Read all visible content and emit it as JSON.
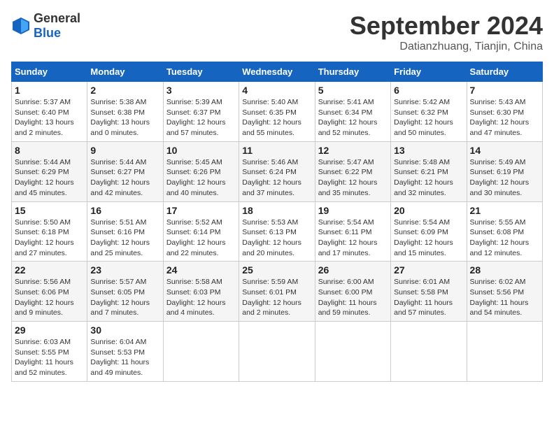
{
  "logo": {
    "general": "General",
    "blue": "Blue"
  },
  "header": {
    "month": "September 2024",
    "location": "Datianzhuang, Tianjin, China"
  },
  "weekdays": [
    "Sunday",
    "Monday",
    "Tuesday",
    "Wednesday",
    "Thursday",
    "Friday",
    "Saturday"
  ],
  "weeks": [
    [
      {
        "day": "1",
        "sunrise": "Sunrise: 5:37 AM",
        "sunset": "Sunset: 6:40 PM",
        "daylight": "Daylight: 13 hours and 2 minutes."
      },
      {
        "day": "2",
        "sunrise": "Sunrise: 5:38 AM",
        "sunset": "Sunset: 6:38 PM",
        "daylight": "Daylight: 13 hours and 0 minutes."
      },
      {
        "day": "3",
        "sunrise": "Sunrise: 5:39 AM",
        "sunset": "Sunset: 6:37 PM",
        "daylight": "Daylight: 12 hours and 57 minutes."
      },
      {
        "day": "4",
        "sunrise": "Sunrise: 5:40 AM",
        "sunset": "Sunset: 6:35 PM",
        "daylight": "Daylight: 12 hours and 55 minutes."
      },
      {
        "day": "5",
        "sunrise": "Sunrise: 5:41 AM",
        "sunset": "Sunset: 6:34 PM",
        "daylight": "Daylight: 12 hours and 52 minutes."
      },
      {
        "day": "6",
        "sunrise": "Sunrise: 5:42 AM",
        "sunset": "Sunset: 6:32 PM",
        "daylight": "Daylight: 12 hours and 50 minutes."
      },
      {
        "day": "7",
        "sunrise": "Sunrise: 5:43 AM",
        "sunset": "Sunset: 6:30 PM",
        "daylight": "Daylight: 12 hours and 47 minutes."
      }
    ],
    [
      {
        "day": "8",
        "sunrise": "Sunrise: 5:44 AM",
        "sunset": "Sunset: 6:29 PM",
        "daylight": "Daylight: 12 hours and 45 minutes."
      },
      {
        "day": "9",
        "sunrise": "Sunrise: 5:44 AM",
        "sunset": "Sunset: 6:27 PM",
        "daylight": "Daylight: 12 hours and 42 minutes."
      },
      {
        "day": "10",
        "sunrise": "Sunrise: 5:45 AM",
        "sunset": "Sunset: 6:26 PM",
        "daylight": "Daylight: 12 hours and 40 minutes."
      },
      {
        "day": "11",
        "sunrise": "Sunrise: 5:46 AM",
        "sunset": "Sunset: 6:24 PM",
        "daylight": "Daylight: 12 hours and 37 minutes."
      },
      {
        "day": "12",
        "sunrise": "Sunrise: 5:47 AM",
        "sunset": "Sunset: 6:22 PM",
        "daylight": "Daylight: 12 hours and 35 minutes."
      },
      {
        "day": "13",
        "sunrise": "Sunrise: 5:48 AM",
        "sunset": "Sunset: 6:21 PM",
        "daylight": "Daylight: 12 hours and 32 minutes."
      },
      {
        "day": "14",
        "sunrise": "Sunrise: 5:49 AM",
        "sunset": "Sunset: 6:19 PM",
        "daylight": "Daylight: 12 hours and 30 minutes."
      }
    ],
    [
      {
        "day": "15",
        "sunrise": "Sunrise: 5:50 AM",
        "sunset": "Sunset: 6:18 PM",
        "daylight": "Daylight: 12 hours and 27 minutes."
      },
      {
        "day": "16",
        "sunrise": "Sunrise: 5:51 AM",
        "sunset": "Sunset: 6:16 PM",
        "daylight": "Daylight: 12 hours and 25 minutes."
      },
      {
        "day": "17",
        "sunrise": "Sunrise: 5:52 AM",
        "sunset": "Sunset: 6:14 PM",
        "daylight": "Daylight: 12 hours and 22 minutes."
      },
      {
        "day": "18",
        "sunrise": "Sunrise: 5:53 AM",
        "sunset": "Sunset: 6:13 PM",
        "daylight": "Daylight: 12 hours and 20 minutes."
      },
      {
        "day": "19",
        "sunrise": "Sunrise: 5:54 AM",
        "sunset": "Sunset: 6:11 PM",
        "daylight": "Daylight: 12 hours and 17 minutes."
      },
      {
        "day": "20",
        "sunrise": "Sunrise: 5:54 AM",
        "sunset": "Sunset: 6:09 PM",
        "daylight": "Daylight: 12 hours and 15 minutes."
      },
      {
        "day": "21",
        "sunrise": "Sunrise: 5:55 AM",
        "sunset": "Sunset: 6:08 PM",
        "daylight": "Daylight: 12 hours and 12 minutes."
      }
    ],
    [
      {
        "day": "22",
        "sunrise": "Sunrise: 5:56 AM",
        "sunset": "Sunset: 6:06 PM",
        "daylight": "Daylight: 12 hours and 9 minutes."
      },
      {
        "day": "23",
        "sunrise": "Sunrise: 5:57 AM",
        "sunset": "Sunset: 6:05 PM",
        "daylight": "Daylight: 12 hours and 7 minutes."
      },
      {
        "day": "24",
        "sunrise": "Sunrise: 5:58 AM",
        "sunset": "Sunset: 6:03 PM",
        "daylight": "Daylight: 12 hours and 4 minutes."
      },
      {
        "day": "25",
        "sunrise": "Sunrise: 5:59 AM",
        "sunset": "Sunset: 6:01 PM",
        "daylight": "Daylight: 12 hours and 2 minutes."
      },
      {
        "day": "26",
        "sunrise": "Sunrise: 6:00 AM",
        "sunset": "Sunset: 6:00 PM",
        "daylight": "Daylight: 11 hours and 59 minutes."
      },
      {
        "day": "27",
        "sunrise": "Sunrise: 6:01 AM",
        "sunset": "Sunset: 5:58 PM",
        "daylight": "Daylight: 11 hours and 57 minutes."
      },
      {
        "day": "28",
        "sunrise": "Sunrise: 6:02 AM",
        "sunset": "Sunset: 5:56 PM",
        "daylight": "Daylight: 11 hours and 54 minutes."
      }
    ],
    [
      {
        "day": "29",
        "sunrise": "Sunrise: 6:03 AM",
        "sunset": "Sunset: 5:55 PM",
        "daylight": "Daylight: 11 hours and 52 minutes."
      },
      {
        "day": "30",
        "sunrise": "Sunrise: 6:04 AM",
        "sunset": "Sunset: 5:53 PM",
        "daylight": "Daylight: 11 hours and 49 minutes."
      },
      null,
      null,
      null,
      null,
      null
    ]
  ]
}
